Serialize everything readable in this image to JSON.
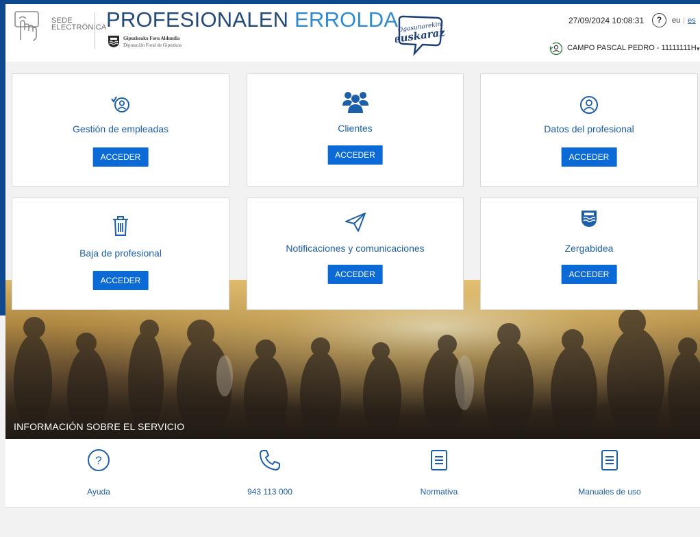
{
  "header": {
    "sede_line1": "SEDE",
    "sede_line2": "ELECTRÓNICA",
    "title_part1": "PROFESIONALEN",
    "title_part2": "ERROLDA",
    "org_line1": "Gipuzkoako Foru Aldundia",
    "org_line2": "Diputación Foral de Gipuzkoa",
    "badge_line1": "Ogasunarekin",
    "badge_line2": "euskaraz",
    "date": "27/09/2024",
    "time": "10:08:31",
    "help": "?",
    "lang_eu": "eu",
    "lang_es": "es",
    "user": "CAMPO PASCAL PEDRO - 11111111H",
    "caret": "▾"
  },
  "cards": [
    {
      "label": "Gestión de empleadas",
      "button": "ACCEDER",
      "icon": "user-search-icon"
    },
    {
      "label": "Clientes",
      "button": "ACCEDER",
      "icon": "users-group-icon"
    },
    {
      "label": "Datos del profesional",
      "button": "ACCEDER",
      "icon": "user-circle-icon"
    },
    {
      "label": "Baja de profesional",
      "button": "ACCEDER",
      "icon": "trash-icon"
    },
    {
      "label": "Notificaciones y comunicaciones",
      "button": "ACCEDER",
      "icon": "paper-plane-icon"
    },
    {
      "label": "Zergabidea",
      "button": "ACCEDER",
      "icon": "shield-coat-icon"
    }
  ],
  "hero": {
    "caption": "INFORMACIÓN SOBRE EL SERVICIO"
  },
  "info": [
    {
      "label": "Ayuda",
      "icon": "help-circle-icon"
    },
    {
      "label": "943 113 000",
      "icon": "phone-icon"
    },
    {
      "label": "Normativa",
      "icon": "document-icon"
    },
    {
      "label": "Manuales de uso",
      "icon": "manual-icon"
    }
  ],
  "colors": {
    "frame": "#10488e",
    "link": "#1c5fa8",
    "button": "#0b6ad6",
    "title_dark": "#234a78",
    "title_light": "#2f8ad0"
  }
}
